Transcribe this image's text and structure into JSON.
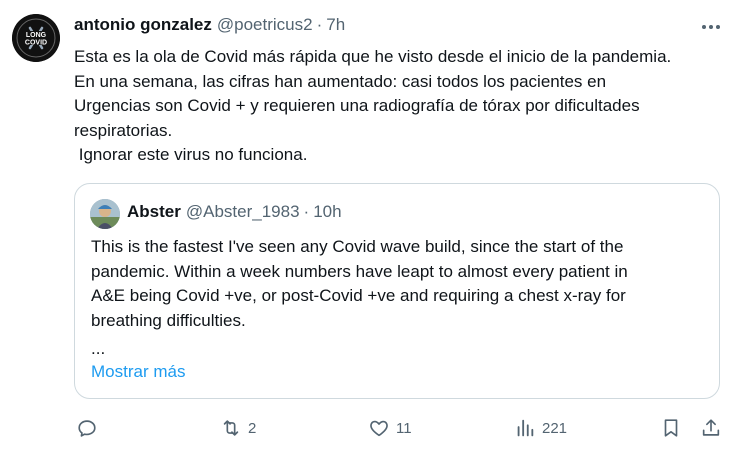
{
  "tweet": {
    "author_name": "antonio gonzalez",
    "handle": "@poetricus2",
    "separator": "·",
    "time": "7h",
    "avatar_text_top": "LONG",
    "avatar_text_bottom": "COVID",
    "more_icon": "more-horizontal-icon",
    "text": "Esta es la ola de Covid más rápida que he visto desde el inicio de la pandemia.\nEn una semana, las cifras han aumentado: casi todos los pacientes en\nUrgencias son Covid + y requieren una radiografía de tórax por dificultades\nrespiratorias.\n Ignorar este virus no funciona."
  },
  "quote": {
    "author_name": "Abster",
    "handle": "@Abster_1983",
    "separator": "·",
    "time": "10h",
    "text": "This is the fastest I've seen any Covid wave build, since the start of the\npandemic. Within a week numbers have leapt to almost every patient in\nA&E being Covid +ve, or post-Covid +ve and requiring a chest x-ray for\nbreathing difficulties.",
    "ellipsis": "...",
    "show_more": "Mostrar más"
  },
  "actions": {
    "reply_icon": "reply-icon",
    "retweet_icon": "retweet-icon",
    "retweet_count": "2",
    "like_icon": "heart-icon",
    "like_count": "11",
    "views_icon": "views-icon",
    "views_count": "221",
    "bookmark_icon": "bookmark-icon",
    "share_icon": "share-icon"
  },
  "colors": {
    "text": "#0f1419",
    "secondary": "#536471",
    "link": "#1d9bf0",
    "border": "#cfd9de"
  }
}
